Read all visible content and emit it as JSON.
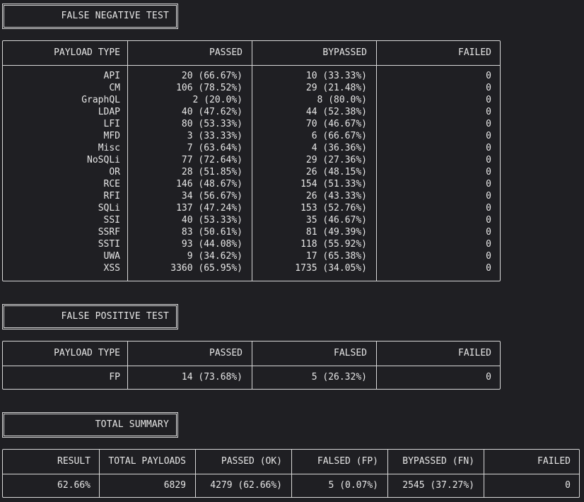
{
  "fn_test": {
    "title": "FALSE NEGATIVE TEST",
    "headers": [
      "PAYLOAD TYPE",
      "PASSED",
      "BYPASSED",
      "FAILED"
    ],
    "rows": [
      [
        "API",
        "20 (66.67%)",
        "10 (33.33%)",
        "0"
      ],
      [
        "CM",
        "106 (78.52%)",
        "29 (21.48%)",
        "0"
      ],
      [
        "GraphQL",
        "2 (20.0%)",
        "8 (80.0%)",
        "0"
      ],
      [
        "LDAP",
        "40 (47.62%)",
        "44 (52.38%)",
        "0"
      ],
      [
        "LFI",
        "80 (53.33%)",
        "70 (46.67%)",
        "0"
      ],
      [
        "MFD",
        "3 (33.33%)",
        "6 (66.67%)",
        "0"
      ],
      [
        "Misc",
        "7 (63.64%)",
        "4 (36.36%)",
        "0"
      ],
      [
        "NoSQLi",
        "77 (72.64%)",
        "29 (27.36%)",
        "0"
      ],
      [
        "OR",
        "28 (51.85%)",
        "26 (48.15%)",
        "0"
      ],
      [
        "RCE",
        "146 (48.67%)",
        "154 (51.33%)",
        "0"
      ],
      [
        "RFI",
        "34 (56.67%)",
        "26 (43.33%)",
        "0"
      ],
      [
        "SQLi",
        "137 (47.24%)",
        "153 (52.76%)",
        "0"
      ],
      [
        "SSI",
        "40 (53.33%)",
        "35 (46.67%)",
        "0"
      ],
      [
        "SSRF",
        "83 (50.61%)",
        "81 (49.39%)",
        "0"
      ],
      [
        "SSTI",
        "93 (44.08%)",
        "118 (55.92%)",
        "0"
      ],
      [
        "UWA",
        "9 (34.62%)",
        "17 (65.38%)",
        "0"
      ],
      [
        "XSS",
        "3360 (65.95%)",
        "1735 (34.05%)",
        "0"
      ]
    ]
  },
  "fp_test": {
    "title": "FALSE POSITIVE TEST",
    "headers": [
      "PAYLOAD TYPE",
      "PASSED",
      "FALSED",
      "FAILED"
    ],
    "rows": [
      [
        "FP",
        "14 (73.68%)",
        "5 (26.32%)",
        "0"
      ]
    ]
  },
  "summary": {
    "title": "TOTAL SUMMARY",
    "headers": [
      "RESULT",
      "TOTAL PAYLOADS",
      "PASSED (OK)",
      "FALSED (FP)",
      "BYPASSED (FN)",
      "FAILED"
    ],
    "row": [
      "62.66%",
      "6829",
      "4279 (62.66%)",
      "5 (0.07%)",
      "2545 (37.27%)",
      "0"
    ]
  },
  "colors": {
    "background": "#1f1f23",
    "text": "#e6e6e6",
    "border": "#d8d8d8"
  }
}
